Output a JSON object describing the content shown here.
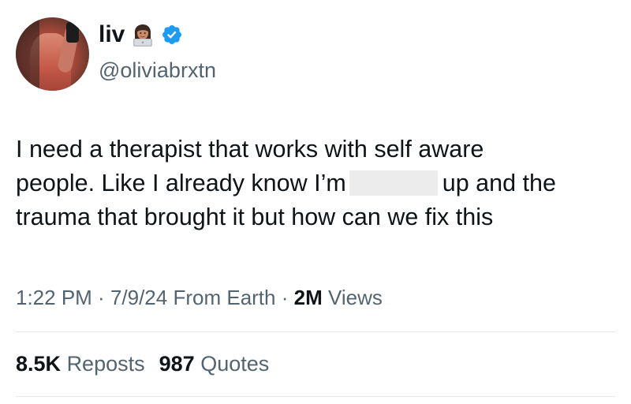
{
  "author": {
    "display_name": "liv",
    "emoji_icon": "woman-technologist-icon",
    "verified_icon": "verified-badge-icon",
    "handle": "@oliviabrxtn"
  },
  "tweet": {
    "line1": "I need a therapist that works with self aware",
    "line2_before": "people. Like I already know I’m",
    "line2_after": "up and the",
    "line3": "trauma that brought it but how can we fix this"
  },
  "meta": {
    "time": "1:22 PM",
    "sep1": " · ",
    "date": "7/9/24",
    "source": "From Earth",
    "sep2": " · ",
    "views_count": "2M",
    "views_label": "Views"
  },
  "stats": {
    "reposts_count": "8.5K",
    "reposts_label": "Reposts",
    "quotes_count": "987",
    "quotes_label": "Quotes"
  },
  "colors": {
    "text": "#0f1419",
    "secondary": "#536471",
    "verified": "#1d9bf0",
    "divider": "#e6e9ec",
    "redaction": "#ececec"
  }
}
